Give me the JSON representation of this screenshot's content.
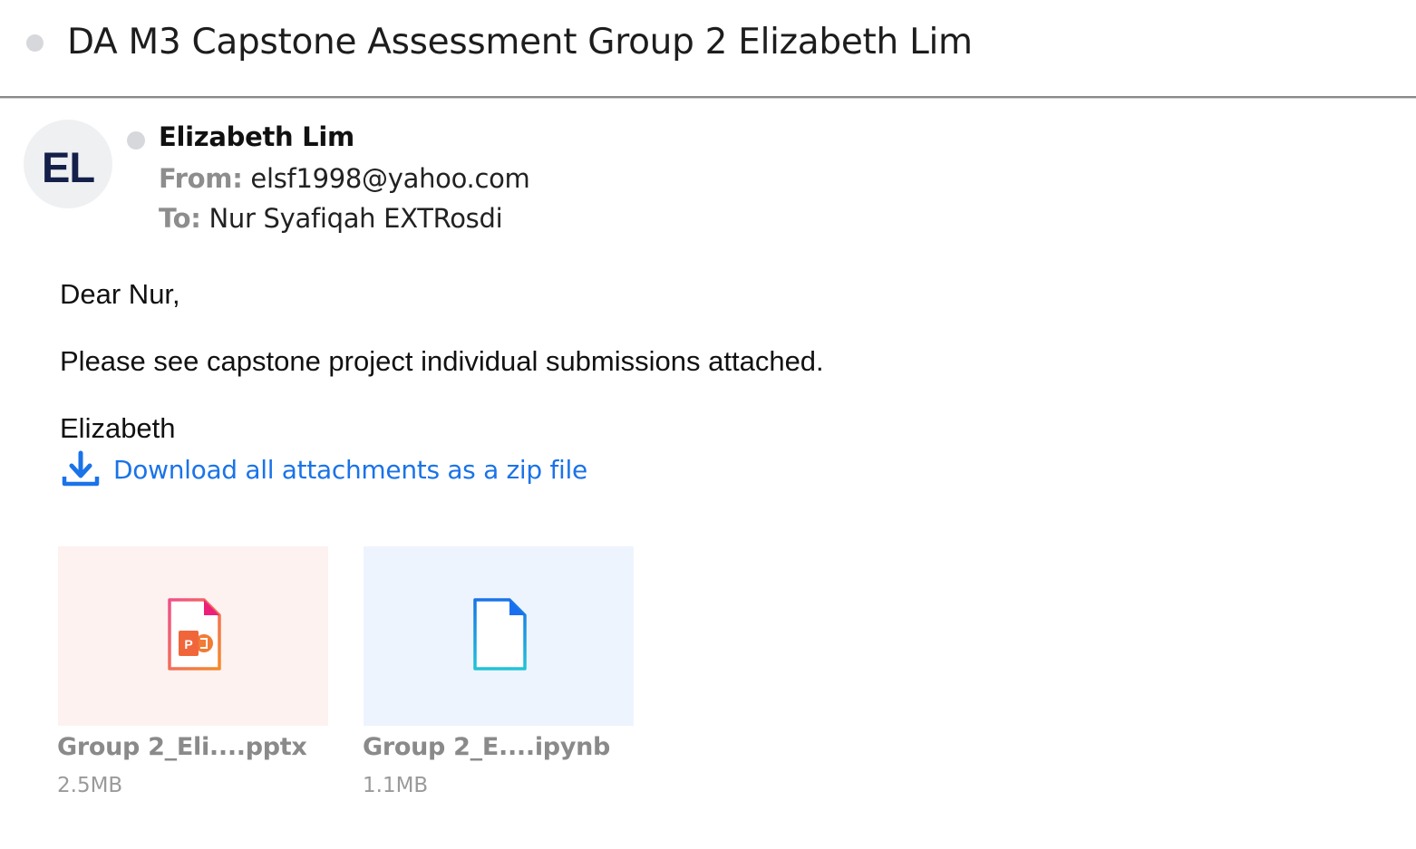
{
  "email": {
    "subject": "DA M3 Capstone Assessment Group 2 Elizabeth Lim",
    "sender": {
      "initials": "EL",
      "name": "Elizabeth Lim",
      "from_label": "From:",
      "from_value": "elsf1998@yahoo.com",
      "to_label": "To:",
      "to_value": "Nur Syafiqah EXTRosdi"
    },
    "body": {
      "greeting": "Dear Nur,",
      "message": "Please see capstone project individual submissions attached.",
      "signature": "Elizabeth"
    },
    "download_all_label": "Download all attachments as a zip file",
    "attachments": [
      {
        "name": "Group 2_Eli....pptx",
        "size": "2.5MB",
        "icon": "powerpoint-file-icon",
        "accent": "#f0508a"
      },
      {
        "name": "Group 2_E....ipynb",
        "size": "1.1MB",
        "icon": "generic-file-icon",
        "accent": "#1a73e8"
      }
    ]
  },
  "colors": {
    "link": "#1a73e8",
    "avatar_text": "#14204a",
    "pptx_thumb_bg": "#fdf2f0",
    "ipynb_thumb_bg": "#eef4fd"
  }
}
